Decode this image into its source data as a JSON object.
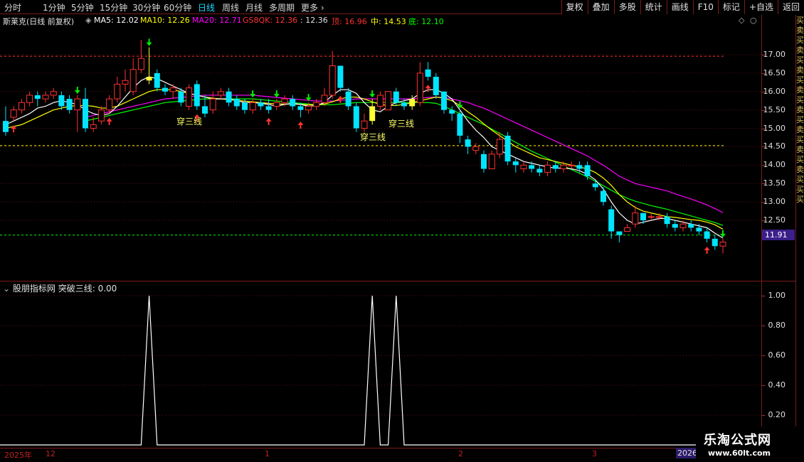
{
  "toolbar": {
    "periods": [
      "分时",
      "1分钟",
      "5分钟",
      "15分钟",
      "30分钟",
      "60分钟",
      "日线",
      "周线",
      "月线",
      "多周期",
      "更多 ›"
    ],
    "active_period": "日线",
    "right_buttons": [
      "复权",
      "叠加",
      "多股",
      "统计",
      "画线",
      "F10",
      "标记",
      "+自选",
      "返回"
    ]
  },
  "info": {
    "stock": "斯莱克(日线 前复权)",
    "ma5": "MA5: 12.02",
    "ma10": "MA10: 12.26",
    "ma20": "MA20: 12.71",
    "gs8qk": "GS8QK: 12.36",
    "gs8qk2": ": 12.36",
    "top": "顶: 16.96",
    "mid": "中: 14.53",
    "bottom": "底: 12.10"
  },
  "colors": {
    "up": "#ff3232",
    "down": "#00e5ff",
    "ma5": "#ffffff",
    "ma10": "#ffff00",
    "ma20": "#ff00ff",
    "ma_green": "#00ff00",
    "top_line": "#ff3030",
    "mid_line": "#ffff00",
    "bottom_line": "#00ff00"
  },
  "price_axis": [
    "17.00",
    "16.50",
    "16.00",
    "15.50",
    "15.00",
    "14.50",
    "14.00",
    "13.50",
    "13.00",
    "12.50"
  ],
  "last_price": "11.91",
  "chart_labels": [
    "穿三线",
    "穿三线",
    "穿三线"
  ],
  "indicator": {
    "header": "股朋指标网 突破三线: 0.00",
    "axis": [
      "1.00",
      "0.80",
      "0.60",
      "0.40",
      "0.20"
    ]
  },
  "xaxis": [
    "2025年",
    "12",
    "1",
    "2",
    "3"
  ],
  "year_badge": "2026",
  "side_strip": "买卖买卖买卖买卖买卖买卖买卖买卖买买买",
  "watermark": {
    "title": "乐淘公式网",
    "url": "www.60lt.com"
  },
  "chart_data": {
    "type": "candlestick",
    "ylim": [
      11.3,
      17.5
    ],
    "reference_lines": {
      "top": 16.96,
      "mid": 14.53,
      "bottom": 12.1
    },
    "candles": [
      [
        15.2,
        14.9,
        15.6,
        14.8
      ],
      [
        15.3,
        15.5,
        15.6,
        15.2
      ],
      [
        15.5,
        15.7,
        15.8,
        15.4
      ],
      [
        15.7,
        15.9,
        16.0,
        15.6
      ],
      [
        15.9,
        15.8,
        16.0,
        15.6
      ],
      [
        15.8,
        15.9,
        16.0,
        15.7
      ],
      [
        15.9,
        16.0,
        16.1,
        15.8
      ],
      [
        15.9,
        15.6,
        16.0,
        15.5
      ],
      [
        15.8,
        15.5,
        15.9,
        15.4
      ],
      [
        15.5,
        15.8,
        15.9,
        14.9
      ],
      [
        15.8,
        15.0,
        16.1,
        14.9
      ],
      [
        15.0,
        15.1,
        15.3,
        14.9
      ],
      [
        15.2,
        15.5,
        15.6,
        15.1
      ],
      [
        15.5,
        15.8,
        15.9,
        15.4
      ],
      [
        15.8,
        16.2,
        16.4,
        15.7
      ],
      [
        16.2,
        16.3,
        16.6,
        16.0
      ],
      [
        16.0,
        16.6,
        16.9,
        15.9
      ],
      [
        16.6,
        16.9,
        17.4,
        16.5
      ],
      [
        16.4,
        16.3,
        17.2,
        16.2
      ],
      [
        16.5,
        16.1,
        16.6,
        16.0
      ],
      [
        16.1,
        16.0,
        16.2,
        15.9
      ],
      [
        16.0,
        16.1,
        16.2,
        15.8
      ],
      [
        16.0,
        15.7,
        16.1,
        15.6
      ],
      [
        15.6,
        16.1,
        16.2,
        15.5
      ],
      [
        16.2,
        15.6,
        16.3,
        15.5
      ],
      [
        15.6,
        15.4,
        15.9,
        15.3
      ],
      [
        15.5,
        15.8,
        16.0,
        15.4
      ],
      [
        15.9,
        16.0,
        16.1,
        15.8
      ],
      [
        16.0,
        15.7,
        16.1,
        15.6
      ],
      [
        15.8,
        15.6,
        15.9,
        15.5
      ],
      [
        15.7,
        15.5,
        15.8,
        15.4
      ],
      [
        15.5,
        15.7,
        15.8,
        15.4
      ],
      [
        15.7,
        15.6,
        15.8,
        15.5
      ],
      [
        15.6,
        15.5,
        15.8,
        15.4
      ],
      [
        15.6,
        15.7,
        15.8,
        15.5
      ],
      [
        15.7,
        15.8,
        15.9,
        15.6
      ],
      [
        15.8,
        15.6,
        15.9,
        15.5
      ],
      [
        15.6,
        15.5,
        15.7,
        15.3
      ],
      [
        15.5,
        15.6,
        15.7,
        15.4
      ],
      [
        15.6,
        15.7,
        15.8,
        15.5
      ],
      [
        15.7,
        15.9,
        16.1,
        15.6
      ],
      [
        15.9,
        16.7,
        17.1,
        15.8
      ],
      [
        16.7,
        16.1,
        16.7,
        16.0
      ],
      [
        16.0,
        15.6,
        16.1,
        15.5
      ],
      [
        15.6,
        15.0,
        15.7,
        14.9
      ],
      [
        15.0,
        15.2,
        15.4,
        14.9
      ],
      [
        15.2,
        15.6,
        15.8,
        15.1
      ],
      [
        15.6,
        15.9,
        16.0,
        15.5
      ],
      [
        15.5,
        16.0,
        16.0,
        15.5
      ],
      [
        16.0,
        15.7,
        16.1,
        15.6
      ],
      [
        15.7,
        15.6,
        15.8,
        15.5
      ],
      [
        15.6,
        15.8,
        15.9,
        15.5
      ],
      [
        15.7,
        16.5,
        16.8,
        15.6
      ],
      [
        16.6,
        16.4,
        16.8,
        16.3
      ],
      [
        16.4,
        15.9,
        16.5,
        15.8
      ],
      [
        16.0,
        15.5,
        16.0,
        15.4
      ],
      [
        15.5,
        15.4,
        15.6,
        15.2
      ],
      [
        15.4,
        14.8,
        15.5,
        14.6
      ],
      [
        14.7,
        14.5,
        14.8,
        14.3
      ],
      [
        14.4,
        14.5,
        14.6,
        14.3
      ],
      [
        14.3,
        13.9,
        14.4,
        13.8
      ],
      [
        13.9,
        14.3,
        14.4,
        13.9
      ],
      [
        14.3,
        14.7,
        14.9,
        14.2
      ],
      [
        14.8,
        14.1,
        14.9,
        14.0
      ],
      [
        14.1,
        14.0,
        14.2,
        13.8
      ],
      [
        13.9,
        14.0,
        14.1,
        13.8
      ],
      [
        14.0,
        13.9,
        14.1,
        13.8
      ],
      [
        13.9,
        13.8,
        14.0,
        13.7
      ],
      [
        13.8,
        14.0,
        14.1,
        13.7
      ],
      [
        14.0,
        13.9,
        14.1,
        13.8
      ],
      [
        13.9,
        14.0,
        14.1,
        13.8
      ],
      [
        14.0,
        14.0,
        14.1,
        13.9
      ],
      [
        14.0,
        13.9,
        14.1,
        13.8
      ],
      [
        14.0,
        13.7,
        14.1,
        13.6
      ],
      [
        13.5,
        13.4,
        13.6,
        13.3
      ],
      [
        13.3,
        13.0,
        13.4,
        12.9
      ],
      [
        12.8,
        12.2,
        12.9,
        12.0
      ],
      [
        12.2,
        12.1,
        12.2,
        11.9
      ],
      [
        12.2,
        12.3,
        12.4,
        12.2
      ],
      [
        12.4,
        12.7,
        12.9,
        12.3
      ],
      [
        12.7,
        12.5,
        12.7,
        12.4
      ],
      [
        12.6,
        12.6,
        12.7,
        12.5
      ],
      [
        12.6,
        12.6,
        12.7,
        12.5
      ],
      [
        12.6,
        12.4,
        12.7,
        12.3
      ],
      [
        12.4,
        12.3,
        12.5,
        12.2
      ],
      [
        12.3,
        12.4,
        12.5,
        12.2
      ],
      [
        12.4,
        12.3,
        12.5,
        12.2
      ],
      [
        12.3,
        12.2,
        12.4,
        12.1
      ],
      [
        12.2,
        12.0,
        12.3,
        11.9
      ],
      [
        12.0,
        11.8,
        12.1,
        11.7
      ],
      [
        11.8,
        11.91,
        12.0,
        11.6
      ]
    ],
    "ma5": [
      15.1,
      15.2,
      15.3,
      15.4,
      15.55,
      15.6,
      15.7,
      15.75,
      15.7,
      15.65,
      15.5,
      15.4,
      15.35,
      15.4,
      15.6,
      15.85,
      16.1,
      16.3,
      16.4,
      16.35,
      16.25,
      16.15,
      16.05,
      15.95,
      15.9,
      15.85,
      15.8,
      15.8,
      15.8,
      15.75,
      15.7,
      15.7,
      15.68,
      15.65,
      15.6,
      15.65,
      15.68,
      15.65,
      15.6,
      15.62,
      15.7,
      15.9,
      16.05,
      16.05,
      15.95,
      15.7,
      15.5,
      15.45,
      15.6,
      15.7,
      15.75,
      15.8,
      15.95,
      16.05,
      16.05,
      15.95,
      15.8,
      15.5,
      15.2,
      14.95,
      14.75,
      14.5,
      14.4,
      14.3,
      14.2,
      14.1,
      14.05,
      14.0,
      13.95,
      13.92,
      13.92,
      13.9,
      13.85,
      13.75,
      13.6,
      13.35,
      13.0,
      12.7,
      12.5,
      12.4,
      12.45,
      12.5,
      12.55,
      12.55,
      12.5,
      12.45,
      12.4,
      12.35,
      12.3,
      12.15,
      12.02
    ],
    "ma10": [
      15.0,
      15.05,
      15.1,
      15.2,
      15.3,
      15.4,
      15.5,
      15.55,
      15.6,
      15.62,
      15.62,
      15.6,
      15.55,
      15.55,
      15.6,
      15.7,
      15.8,
      15.9,
      16.0,
      16.05,
      16.05,
      16.05,
      16.0,
      15.95,
      15.9,
      15.85,
      15.82,
      15.8,
      15.78,
      15.76,
      15.74,
      15.72,
      15.7,
      15.68,
      15.66,
      15.66,
      15.66,
      15.65,
      15.64,
      15.64,
      15.66,
      15.72,
      15.8,
      15.85,
      15.85,
      15.8,
      15.72,
      15.65,
      15.62,
      15.62,
      15.65,
      15.7,
      15.75,
      15.8,
      15.85,
      15.82,
      15.75,
      15.62,
      15.45,
      15.3,
      15.12,
      14.95,
      14.8,
      14.65,
      14.5,
      14.4,
      14.3,
      14.2,
      14.15,
      14.1,
      14.05,
      14.0,
      13.95,
      13.9,
      13.8,
      13.65,
      13.45,
      13.2,
      13.0,
      12.85,
      12.75,
      12.7,
      12.65,
      12.6,
      12.58,
      12.55,
      12.52,
      12.5,
      12.45,
      12.38,
      12.26
    ],
    "ma20": [
      null,
      null,
      null,
      null,
      null,
      null,
      null,
      null,
      null,
      null,
      15.3,
      15.35,
      15.4,
      15.45,
      15.5,
      15.55,
      15.6,
      15.65,
      15.7,
      15.75,
      15.8,
      15.82,
      15.84,
      15.86,
      15.88,
      15.9,
      15.9,
      15.9,
      15.9,
      15.9,
      15.9,
      15.9,
      15.88,
      15.86,
      15.84,
      15.82,
      15.8,
      15.78,
      15.76,
      15.74,
      15.74,
      15.74,
      15.76,
      15.78,
      15.8,
      15.8,
      15.8,
      15.8,
      15.8,
      15.8,
      15.8,
      15.8,
      15.82,
      15.84,
      15.85,
      15.84,
      15.8,
      15.75,
      15.7,
      15.62,
      15.55,
      15.45,
      15.35,
      15.25,
      15.15,
      15.05,
      14.95,
      14.85,
      14.75,
      14.65,
      14.55,
      14.45,
      14.35,
      14.25,
      14.12,
      14.0,
      13.85,
      13.7,
      13.6,
      13.5,
      13.45,
      13.4,
      13.35,
      13.3,
      13.22,
      13.15,
      13.08,
      13.0,
      12.92,
      12.82,
      12.71
    ],
    "ma60": [
      null,
      null,
      null,
      null,
      null,
      null,
      null,
      null,
      null,
      null,
      15.2,
      15.25,
      15.3,
      15.35,
      15.4,
      15.45,
      15.5,
      15.55,
      15.6,
      15.65,
      15.7,
      15.72,
      15.74,
      15.76,
      15.78,
      15.8,
      15.8,
      15.8,
      15.8,
      15.8,
      15.8,
      15.8,
      15.78,
      15.76,
      15.74,
      15.72,
      15.7,
      15.68,
      15.66,
      15.64,
      15.64,
      15.64,
      15.66,
      15.68,
      15.7,
      15.7,
      15.7,
      15.7,
      15.7,
      15.7,
      15.7,
      15.7,
      15.7,
      15.7,
      15.68,
      15.6,
      15.5,
      15.4,
      15.3,
      15.2,
      15.1,
      14.98,
      14.86,
      14.74,
      14.62,
      14.5,
      14.38,
      14.28,
      14.18,
      14.08,
      13.98,
      13.88,
      13.78,
      13.68,
      13.56,
      13.44,
      13.32,
      13.2,
      13.1,
      13.02,
      12.96,
      12.9,
      12.85,
      12.8,
      12.74,
      12.68,
      12.62,
      12.56,
      12.5,
      12.44,
      12.36
    ],
    "up_arrows": [
      1,
      13,
      24,
      33,
      37,
      42,
      53,
      88
    ],
    "down_arrows": [
      9,
      18,
      31,
      34,
      38,
      46,
      57,
      90
    ],
    "highlight_bars": [
      18,
      46,
      51
    ],
    "signal": [
      0,
      0,
      0,
      0,
      0,
      0,
      0,
      0,
      0,
      0,
      0,
      0,
      0,
      0,
      0,
      0,
      0,
      0,
      1,
      0,
      0,
      0,
      0,
      0,
      0,
      0,
      0,
      0,
      0,
      0,
      0,
      0,
      0,
      0,
      0,
      0,
      0,
      0,
      0,
      0,
      0,
      0,
      0,
      0,
      0,
      0,
      1,
      0,
      0,
      1,
      0,
      0,
      0,
      0,
      0,
      0,
      0,
      0,
      0,
      0,
      0,
      0,
      0,
      0,
      0,
      0,
      0,
      0,
      0,
      0,
      0,
      0,
      0,
      0,
      0,
      0,
      0,
      0,
      0,
      0,
      0,
      0,
      0,
      0,
      0,
      0,
      0,
      0,
      0,
      0,
      0
    ]
  }
}
